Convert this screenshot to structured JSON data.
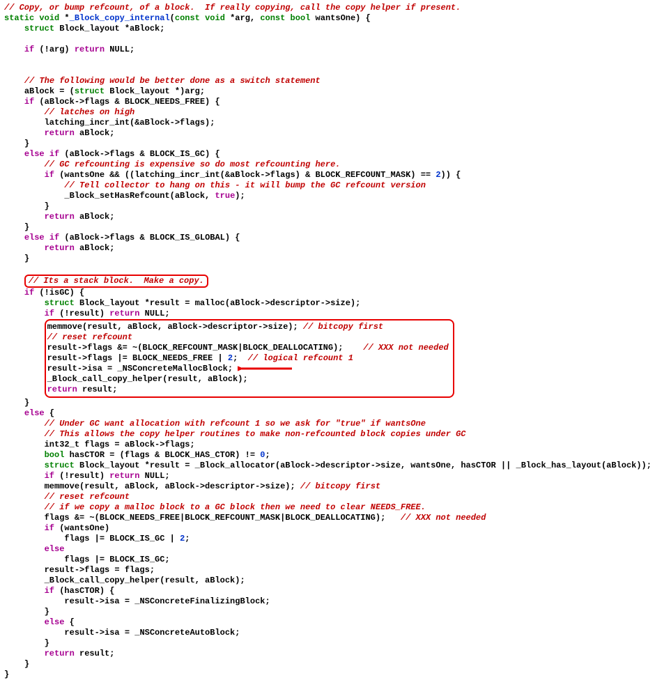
{
  "code": {
    "c1": "// Copy, or bump refcount, of a block.  If really copying, call the copy helper if present.",
    "l2a": "static",
    "l2b": "void",
    "l2c": " *",
    "l2d": "_Block_copy_internal",
    "l2e": "(",
    "l2f": "const",
    "l2g": " void",
    "l2h": " *arg, ",
    "l2i": "const",
    "l2j": " bool",
    "l2k": " wantsOne) {",
    "l3a": "struct",
    "l3b": " Block_layout *aBlock;",
    "l4a": "if",
    "l4b": " (!arg) ",
    "l4c": "return",
    "l4d": " NULL;",
    "c5": "// The following would be better done as a switch statement",
    "l6a": "aBlock = (",
    "l6b": "struct",
    "l6c": " Block_layout *)arg;",
    "l7a": "if",
    "l7b": " (aBlock->flags & BLOCK_NEEDS_FREE) {",
    "c8": "// latches on high",
    "l9": "latching_incr_int(&aBlock->flags);",
    "l10a": "return",
    "l10b": " aBlock;",
    "l11": "}",
    "l12a": "else",
    "l12b": " if",
    "l12c": " (aBlock->flags & BLOCK_IS_GC) {",
    "c13": "// GC refcounting is expensive so do most refcounting here.",
    "l14a": "if",
    "l14b": " (wantsOne && ((latching_incr_int(&aBlock->flags) & BLOCK_REFCOUNT_MASK) == ",
    "l14c": "2",
    "l14d": ")) {",
    "c15": "// Tell collector to hang on this - it will bump the GC refcount version",
    "l16a": "_Block_setHasRefcount(aBlock, ",
    "l16b": "true",
    "l16c": ");",
    "l17": "}",
    "l18a": "return",
    "l18b": " aBlock;",
    "l19": "}",
    "l20a": "else",
    "l20b": " if",
    "l20c": " (aBlock->flags & BLOCK_IS_GLOBAL) {",
    "l21a": "return",
    "l21b": " aBlock;",
    "l22": "}",
    "c23": "// Its a stack block.  Make a copy.",
    "l24a": "if",
    "l24b": " (!isGC) {",
    "l25a": "struct",
    "l25b": " Block_layout *result = malloc(aBlock->descriptor->size);",
    "l26a": "if",
    "l26b": " (!result) ",
    "l26c": "return",
    "l26d": " NULL;",
    "l27a": "memmove(result, aBlock, aBlock->descriptor->size); ",
    "c27": "// bitcopy first",
    "c28": "// reset refcount",
    "l29a": "result->flags &= ~(BLOCK_REFCOUNT_MASK|BLOCK_DEALLOCATING);    ",
    "c29": "// XXX not needed",
    "l30a": "result->flags |= BLOCK_NEEDS_FREE | ",
    "l30b": "2",
    "l30c": ";  ",
    "c30": "// logical refcount 1",
    "l31": "result->isa = _NSConcreteMallocBlock;",
    "l32": "_Block_call_copy_helper(result, aBlock);",
    "l33a": "return",
    "l33b": " result;",
    "l34": "}",
    "l35a": "else",
    "l35b": " {",
    "c36": "// Under GC want allocation with refcount 1 so we ask for \"true\" if wantsOne",
    "c37": "// This allows the copy helper routines to make non-refcounted block copies under GC",
    "l38": "int32_t flags = aBlock->flags;",
    "l39a": "bool",
    "l39b": " hasCTOR = (flags & BLOCK_HAS_CTOR) != ",
    "l39c": "0",
    "l39d": ";",
    "l40a": "struct",
    "l40b": " Block_layout *result = _Block_allocator(aBlock->descriptor->size, wantsOne, hasCTOR || _Block_has_layout(aBlock));",
    "l41a": "if",
    "l41b": " (!result) ",
    "l41c": "return",
    "l41d": " NULL;",
    "l42a": "memmove(result, aBlock, aBlock->descriptor->size); ",
    "c42": "// bitcopy first",
    "c43": "// reset refcount",
    "c44": "// if we copy a malloc block to a GC block then we need to clear NEEDS_FREE.",
    "l45a": "flags &= ~(BLOCK_NEEDS_FREE|BLOCK_REFCOUNT_MASK|BLOCK_DEALLOCATING);   ",
    "c45": "// XXX not needed",
    "l46a": "if",
    "l46b": " (wantsOne)",
    "l47a": "flags |= BLOCK_IS_GC | ",
    "l47b": "2",
    "l47c": ";",
    "l48": "else",
    "l49": "flags |= BLOCK_IS_GC;",
    "l50": "result->flags = flags;",
    "l51": "_Block_call_copy_helper(result, aBlock);",
    "l52a": "if",
    "l52b": " (hasCTOR) {",
    "l53": "result->isa = _NSConcreteFinalizingBlock;",
    "l54": "}",
    "l55a": "else",
    "l55b": " {",
    "l56": "result->isa = _NSConcreteAutoBlock;",
    "l57": "}",
    "l58a": "return",
    "l58b": " result;",
    "l59": "}",
    "l60": "}"
  },
  "annotations": {
    "highlight1_desc": "Red rounded box around stack-block comment",
    "highlight2_desc": "Red rounded box around memmove/flags/isa assignment section",
    "arrow_desc": "Red arrow pointing at result->isa = _NSConcreteMallocBlock;"
  },
  "colors": {
    "comment": "#c00000",
    "keyword": "#008000",
    "control": "#a60090",
    "ident": "#0033cc",
    "box": "#e80000"
  }
}
